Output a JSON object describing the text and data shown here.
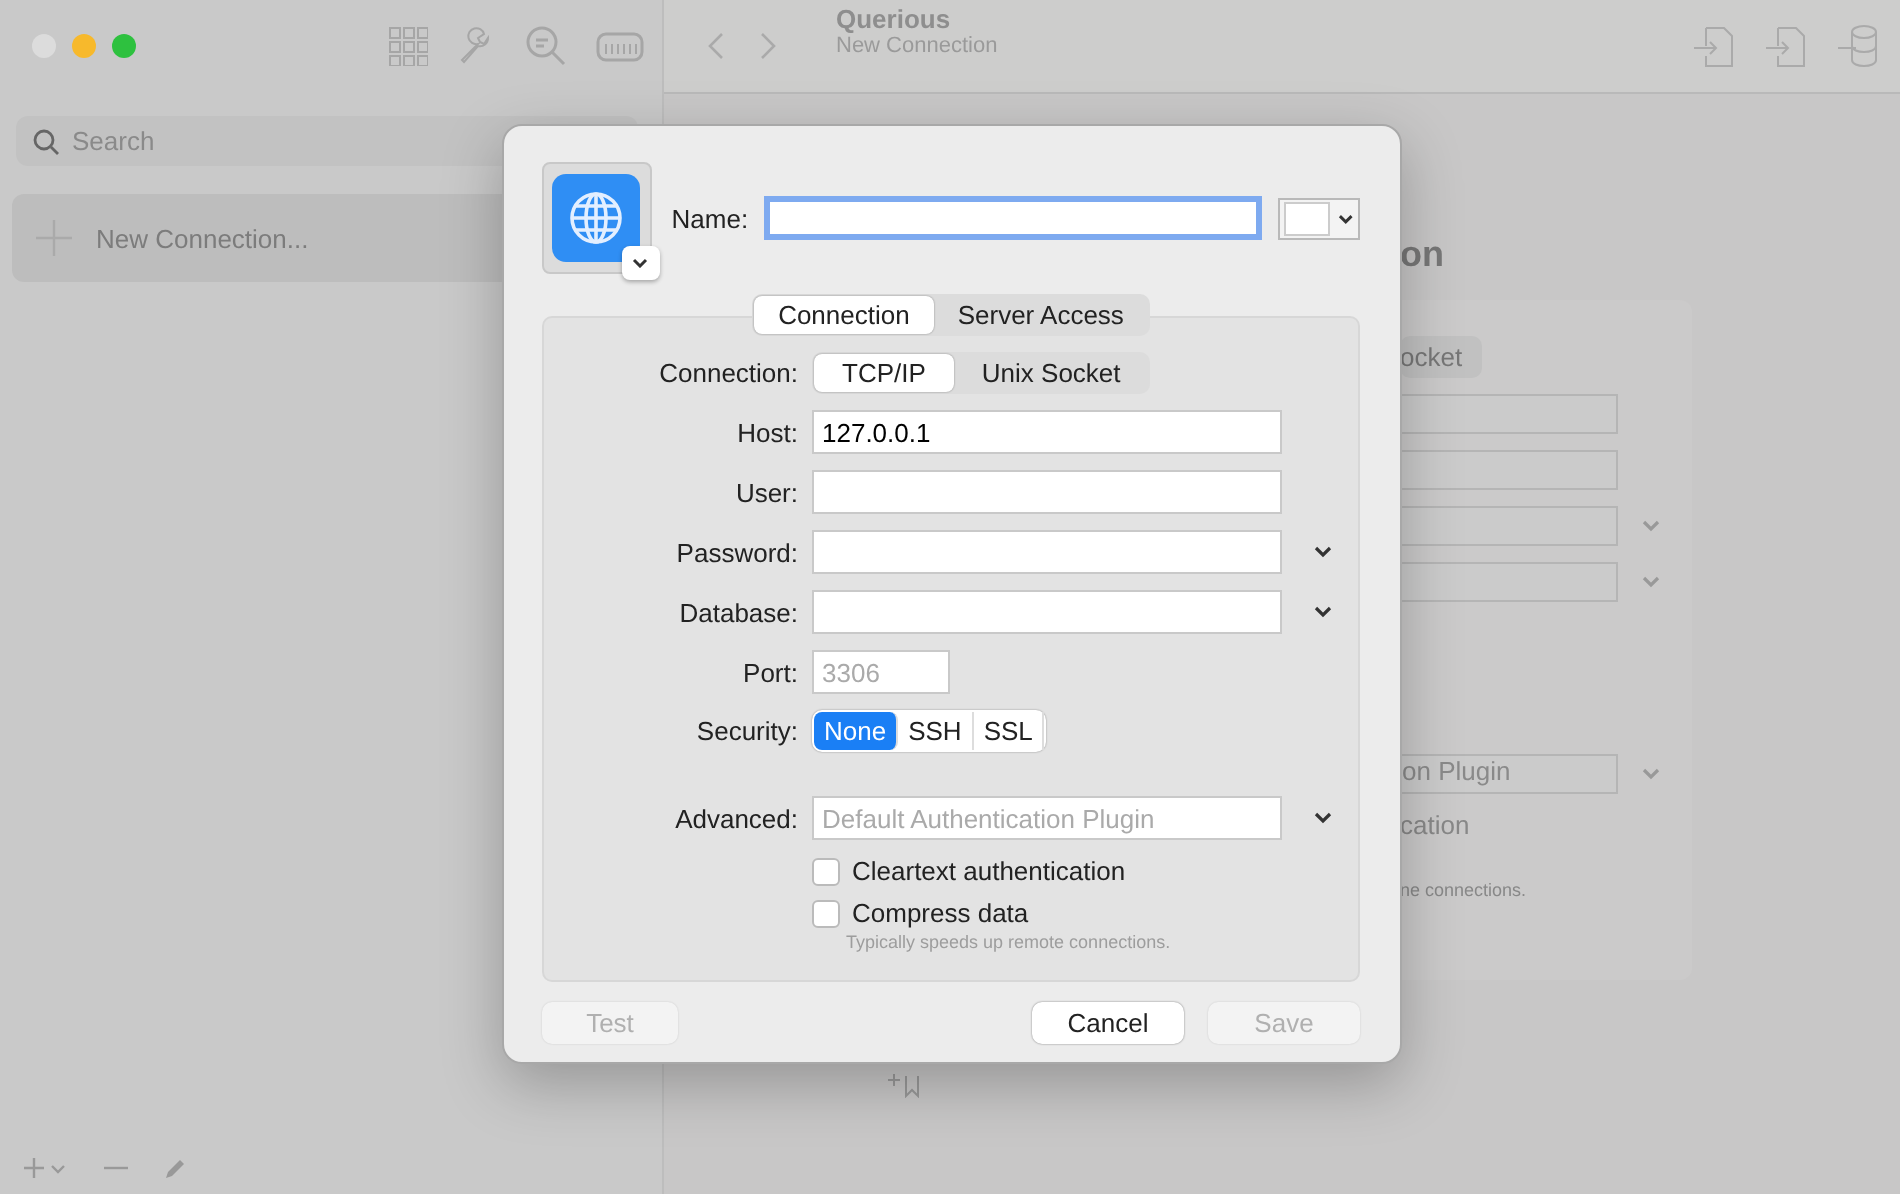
{
  "window": {
    "title": "Querious",
    "subtitle": "New Connection"
  },
  "sidebar": {
    "search": {
      "placeholder": "Search"
    },
    "items": [
      {
        "label": "New Connection...",
        "selected": true
      }
    ]
  },
  "background_form": {
    "title": "on",
    "segment": "ocket",
    "advanced_placeholder": "on Plugin",
    "checkbox_label": "cation",
    "hint": "ne connections."
  },
  "dialog": {
    "name": {
      "label": "Name:",
      "focused": true
    },
    "tabs": [
      {
        "label": "Connection",
        "selected": true
      },
      {
        "label": "Server Access",
        "selected": false
      }
    ],
    "rows": [
      {
        "kind": "segmented",
        "label": "Connection:",
        "options": [
          {
            "label": "TCP/IP",
            "selected": true
          },
          {
            "label": "Unix Socket",
            "selected": false
          }
        ]
      },
      {
        "kind": "field",
        "label": "Host:",
        "value": "127.0.0.1"
      },
      {
        "kind": "field",
        "label": "User:"
      },
      {
        "kind": "combo",
        "label": "Password:"
      },
      {
        "kind": "combo",
        "label": "Database:"
      },
      {
        "kind": "short",
        "label": "Port:",
        "placeholder": "3306"
      },
      {
        "kind": "segmented",
        "label": "Security:",
        "options": [
          {
            "label": "None",
            "selected": true
          },
          {
            "label": "SSH",
            "selected": false
          },
          {
            "label": "SSL",
            "selected": false
          }
        ]
      },
      {
        "kind": "combo",
        "label": "Advanced:",
        "placeholder": "Default Authentication Plugin"
      }
    ],
    "checkboxes": [
      {
        "label": "Cleartext authentication",
        "checked": false
      },
      {
        "label": "Compress data",
        "checked": false
      }
    ],
    "hint": "Typically speeds up remote connections.",
    "buttons": [
      {
        "label": "Test",
        "disabled": true,
        "kind": "left"
      },
      {
        "label": "Cancel",
        "disabled": false,
        "kind": "right"
      },
      {
        "label": "Save",
        "disabled": true,
        "kind": "right"
      }
    ]
  }
}
